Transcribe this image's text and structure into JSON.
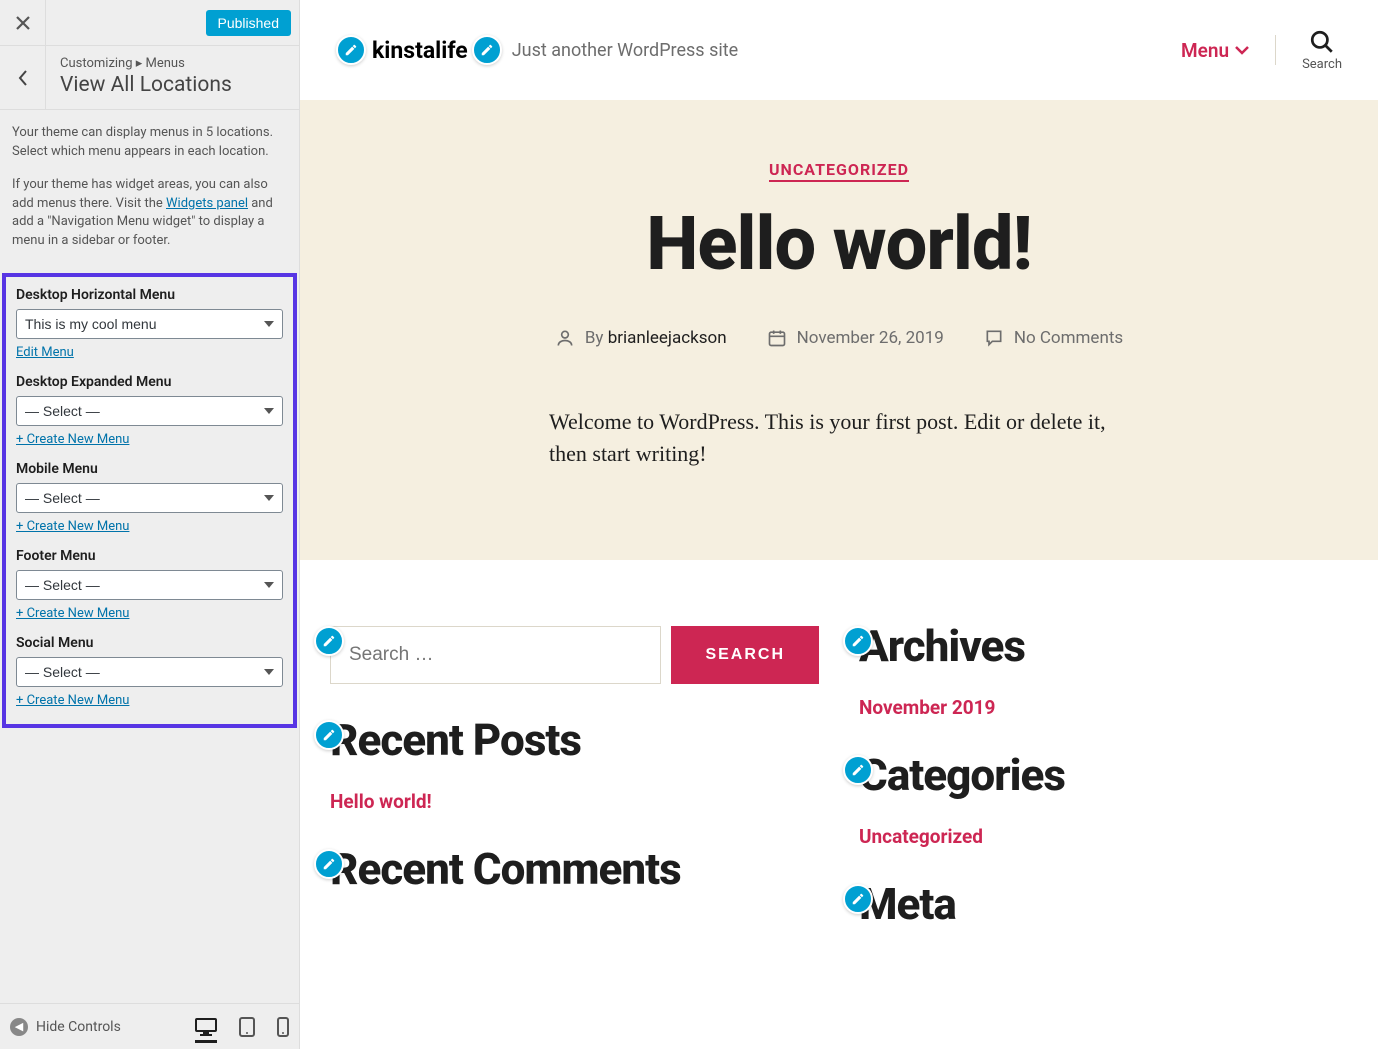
{
  "sidebar": {
    "published_label": "Published",
    "breadcrumb": "Customizing ▸ Menus",
    "title": "View All Locations",
    "desc1": "Your theme can display menus in 5 locations. Select which menu appears in each location.",
    "desc2_a": "If your theme has widget areas, you can also add menus there. Visit the ",
    "widgets_link": "Widgets panel",
    "desc2_b": " and add a \"Navigation Menu widget\" to display a menu in a sidebar or footer.",
    "locations": [
      {
        "label": "Desktop Horizontal Menu",
        "value": "This is my cool menu",
        "action": "Edit Menu"
      },
      {
        "label": "Desktop Expanded Menu",
        "value": "— Select —",
        "action": "+ Create New Menu"
      },
      {
        "label": "Mobile Menu",
        "value": "— Select —",
        "action": "+ Create New Menu"
      },
      {
        "label": "Footer Menu",
        "value": "— Select —",
        "action": "+ Create New Menu"
      },
      {
        "label": "Social Menu",
        "value": "— Select —",
        "action": "+ Create New Menu"
      }
    ],
    "hide_controls": "Hide Controls"
  },
  "preview": {
    "site_title": "kinstalife",
    "tagline": "Just another WordPress site",
    "menu_label": "Menu",
    "search_label": "Search",
    "category": "UNCATEGORIZED",
    "post_title": "Hello world!",
    "by_label": "By",
    "author": "brianleejackson",
    "date": "November 26, 2019",
    "comments": "No Comments",
    "excerpt": "Welcome to WordPress. This is your first post. Edit or delete it, then start writing!",
    "search_placeholder": "Search …",
    "search_button": "SEARCH",
    "widgets": {
      "recent_posts_title": "Recent Posts",
      "recent_posts_link": "Hello world!",
      "recent_comments_title": "Recent Comments",
      "archives_title": "Archives",
      "archives_link": "November 2019",
      "categories_title": "Categories",
      "categories_link": "Uncategorized",
      "meta_title": "Meta"
    }
  }
}
